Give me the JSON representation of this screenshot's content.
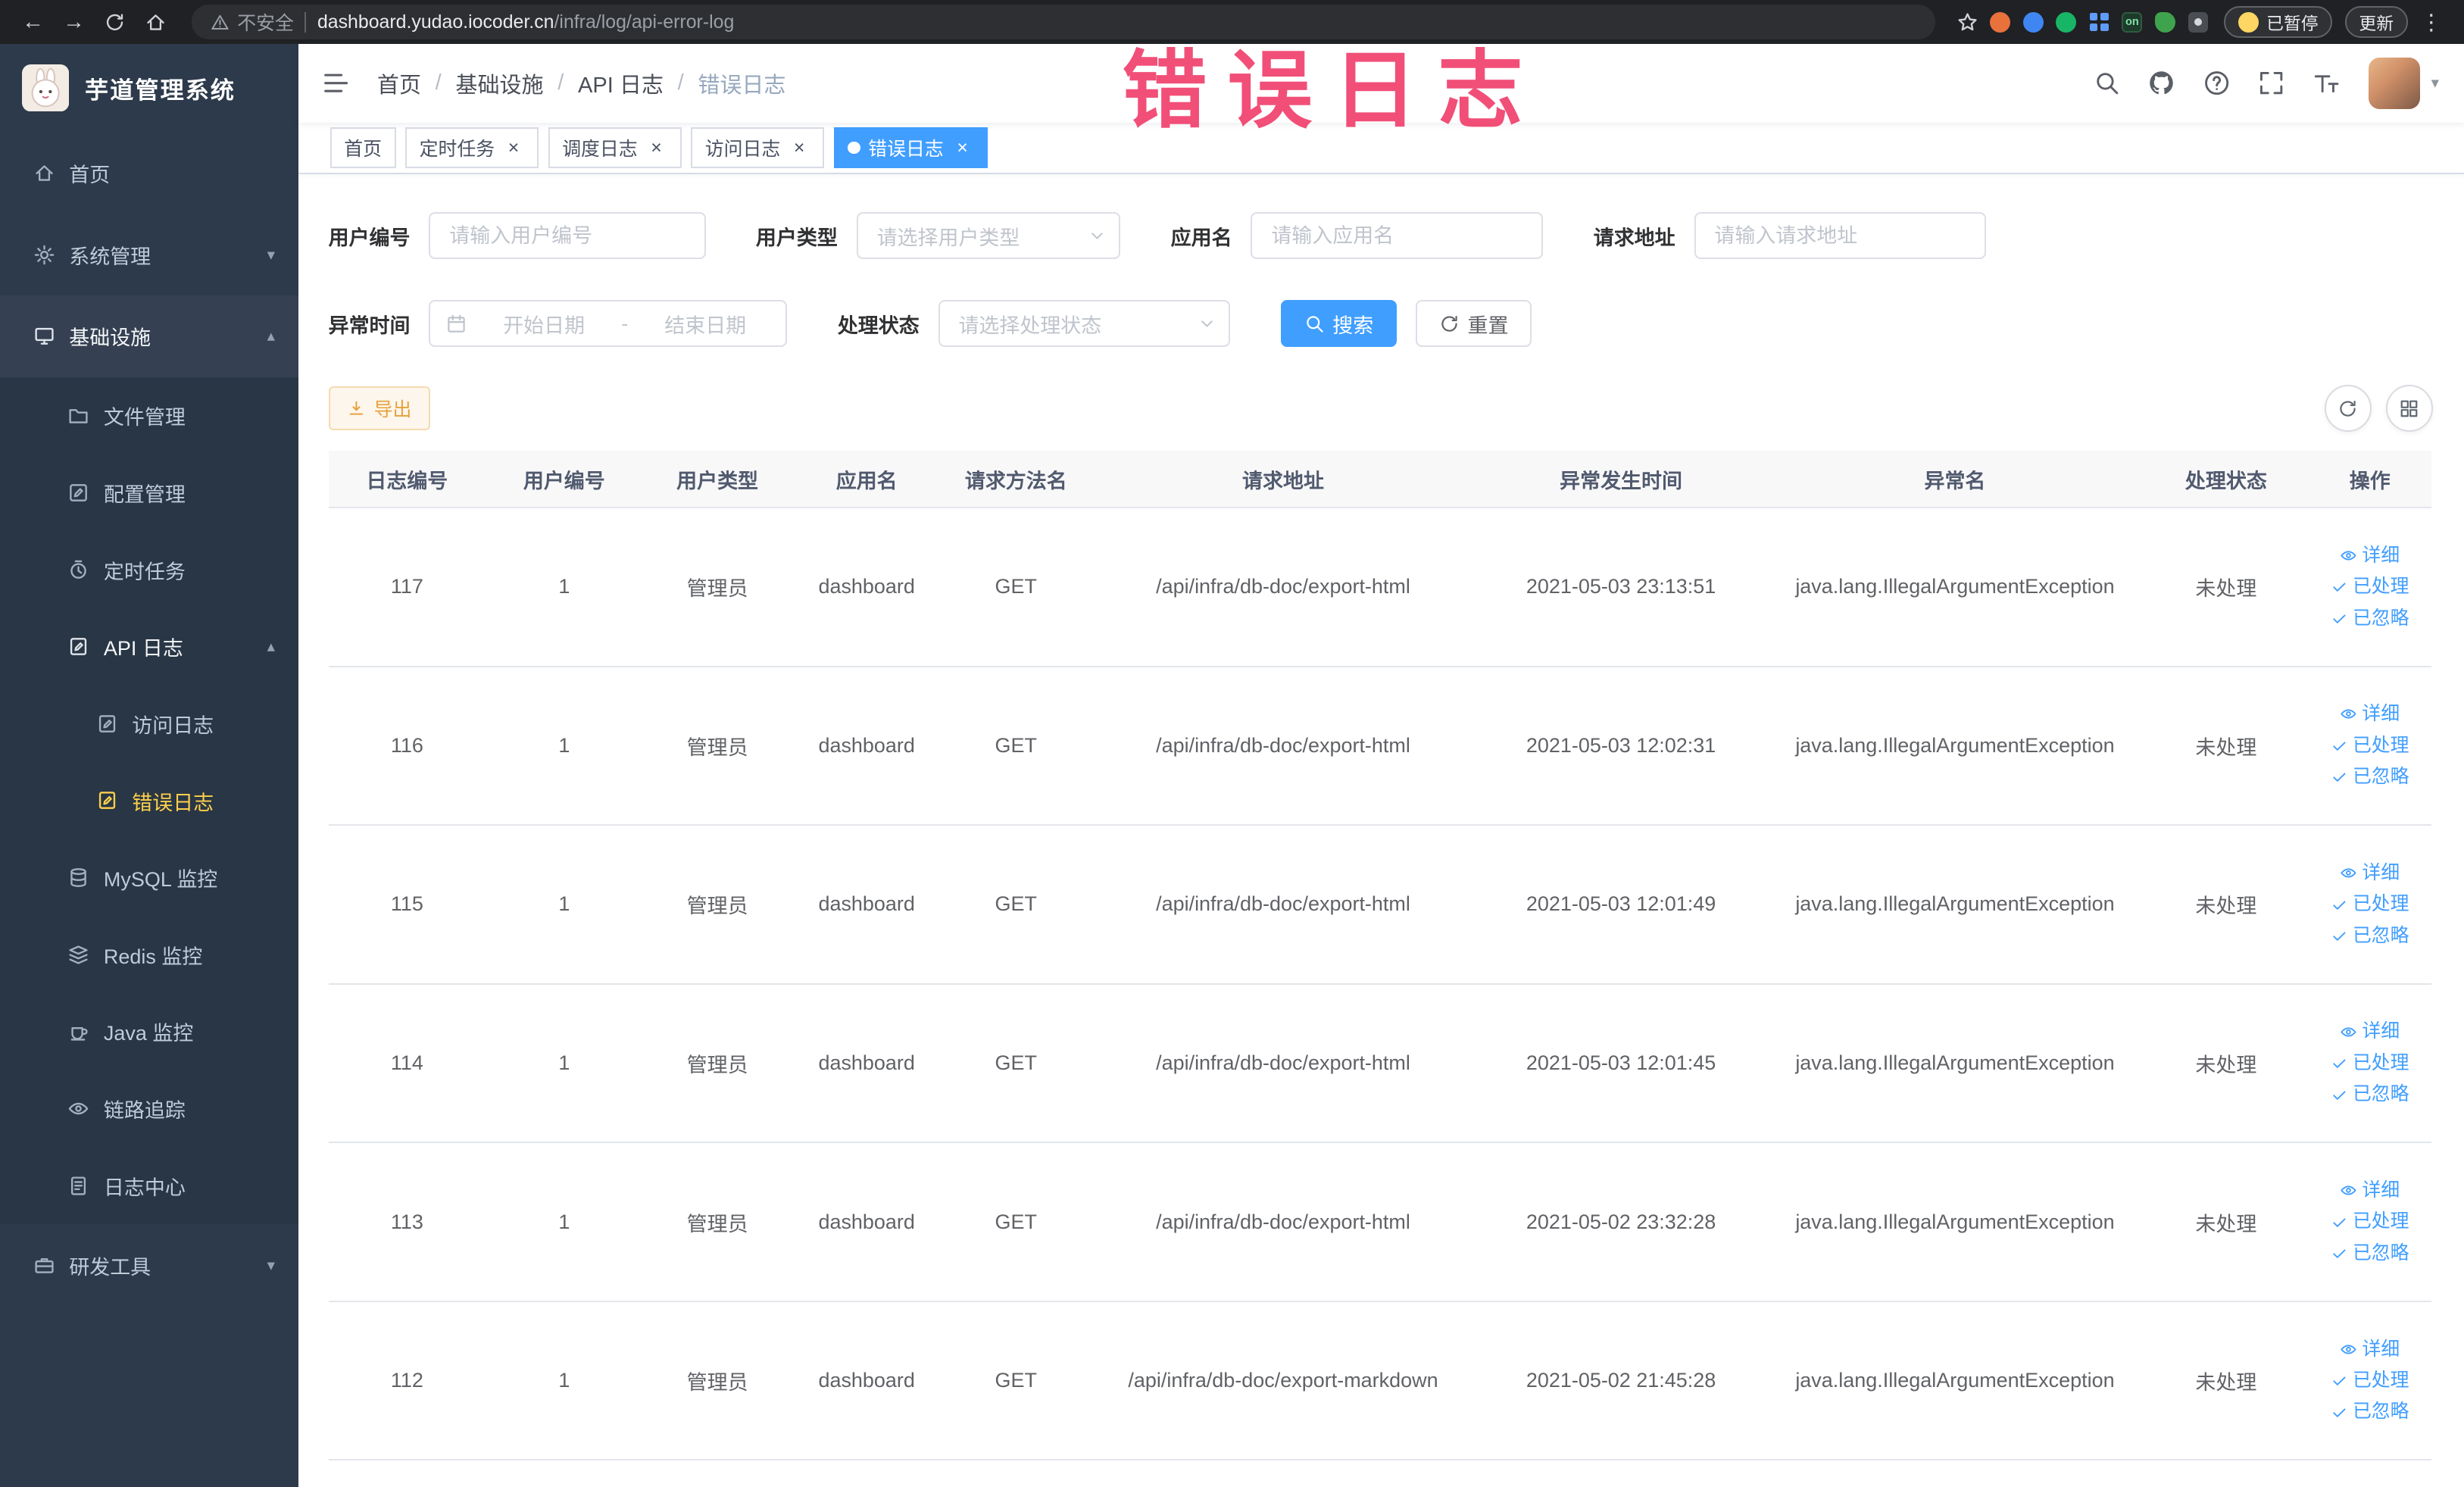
{
  "browser": {
    "security_label": "不安全",
    "url_host": "dashboard.yudao.iocoder.cn",
    "url_path": "/infra/log/api-error-log",
    "extension_on_badge": "on",
    "paused_badge": "已暂停",
    "update_button": "更新"
  },
  "sidebar": {
    "logo_title": "芋道管理系统",
    "items": [
      {
        "key": "home",
        "label": "首页",
        "icon": "home-icon",
        "level": 1
      },
      {
        "key": "system-mgmt",
        "label": "系统管理",
        "icon": "gear-icon",
        "level": 1,
        "chevron": "down"
      },
      {
        "key": "infrastructure",
        "label": "基础设施",
        "icon": "monitor-icon",
        "level": 1,
        "chevron": "up",
        "open": true
      },
      {
        "key": "file-mgmt",
        "label": "文件管理",
        "icon": "folder-icon",
        "level": 2
      },
      {
        "key": "config-mgmt",
        "label": "配置管理",
        "icon": "edit-square-icon",
        "level": 2
      },
      {
        "key": "scheduled-jobs",
        "label": "定时任务",
        "icon": "clock-icon",
        "level": 2
      },
      {
        "key": "api-log",
        "label": "API 日志",
        "icon": "doc-edit-icon",
        "level": 2,
        "chevron": "up",
        "open": true
      },
      {
        "key": "access-log",
        "label": "访问日志",
        "icon": "doc-edit-icon",
        "level": 3
      },
      {
        "key": "error-log",
        "label": "错误日志",
        "icon": "doc-edit-icon",
        "level": 3,
        "active": true
      },
      {
        "key": "mysql-monitor",
        "label": "MySQL 监控",
        "icon": "database-icon",
        "level": 2
      },
      {
        "key": "redis-monitor",
        "label": "Redis 监控",
        "icon": "layers-icon",
        "level": 2
      },
      {
        "key": "java-monitor",
        "label": "Java 监控",
        "icon": "coffee-icon",
        "level": 2
      },
      {
        "key": "trace",
        "label": "链路追踪",
        "icon": "eye-icon",
        "level": 2
      },
      {
        "key": "log-center",
        "label": "日志中心",
        "icon": "doc-icon",
        "level": 2
      },
      {
        "key": "dev-tools",
        "label": "研发工具",
        "icon": "briefcase-icon",
        "level": 1,
        "chevron": "down"
      }
    ]
  },
  "navbar": {
    "breadcrumb": [
      "首页",
      "基础设施",
      "API 日志",
      "错误日志"
    ]
  },
  "annotation": "错误日志",
  "tags": [
    {
      "key": "home",
      "label": "首页",
      "closable": false,
      "active": false
    },
    {
      "key": "scheduled-jobs",
      "label": "定时任务",
      "closable": true,
      "active": false
    },
    {
      "key": "schedule-log",
      "label": "调度日志",
      "closable": true,
      "active": false
    },
    {
      "key": "access-log",
      "label": "访问日志",
      "closable": true,
      "active": false
    },
    {
      "key": "error-log",
      "label": "错误日志",
      "closable": true,
      "active": true
    }
  ],
  "filters": {
    "user_id": {
      "label": "用户编号",
      "placeholder": "请输入用户编号",
      "value": ""
    },
    "user_type": {
      "label": "用户类型",
      "placeholder": "请选择用户类型",
      "value": ""
    },
    "app_name": {
      "label": "应用名",
      "placeholder": "请输入应用名",
      "value": ""
    },
    "request_url": {
      "label": "请求地址",
      "placeholder": "请输入请求地址",
      "value": ""
    },
    "exception_time": {
      "label": "异常时间",
      "start_placeholder": "开始日期",
      "separator": "-",
      "end_placeholder": "结束日期"
    },
    "process_status": {
      "label": "处理状态",
      "placeholder": "请选择处理状态",
      "value": ""
    },
    "search_button": "搜索",
    "reset_button": "重置"
  },
  "toolbar": {
    "export_button": "导出"
  },
  "table": {
    "columns": [
      "日志编号",
      "用户编号",
      "用户类型",
      "应用名",
      "请求方法名",
      "请求地址",
      "异常发生时间",
      "异常名",
      "处理状态",
      "操作"
    ],
    "row_actions": [
      "详细",
      "已处理",
      "已忽略"
    ],
    "rows": [
      {
        "log_id": "117",
        "user_id": "1",
        "user_type": "管理员",
        "app_name": "dashboard",
        "method": "GET",
        "url": "/api/infra/db-doc/export-html",
        "time": "2021-05-03 23:13:51",
        "exception": "java.lang.IllegalArgumentException",
        "status": "未处理"
      },
      {
        "log_id": "116",
        "user_id": "1",
        "user_type": "管理员",
        "app_name": "dashboard",
        "method": "GET",
        "url": "/api/infra/db-doc/export-html",
        "time": "2021-05-03 12:02:31",
        "exception": "java.lang.IllegalArgumentException",
        "status": "未处理"
      },
      {
        "log_id": "115",
        "user_id": "1",
        "user_type": "管理员",
        "app_name": "dashboard",
        "method": "GET",
        "url": "/api/infra/db-doc/export-html",
        "time": "2021-05-03 12:01:49",
        "exception": "java.lang.IllegalArgumentException",
        "status": "未处理"
      },
      {
        "log_id": "114",
        "user_id": "1",
        "user_type": "管理员",
        "app_name": "dashboard",
        "method": "GET",
        "url": "/api/infra/db-doc/export-html",
        "time": "2021-05-03 12:01:45",
        "exception": "java.lang.IllegalArgumentException",
        "status": "未处理"
      },
      {
        "log_id": "113",
        "user_id": "1",
        "user_type": "管理员",
        "app_name": "dashboard",
        "method": "GET",
        "url": "/api/infra/db-doc/export-html",
        "time": "2021-05-02 23:32:28",
        "exception": "java.lang.IllegalArgumentException",
        "status": "未处理"
      },
      {
        "log_id": "112",
        "user_id": "1",
        "user_type": "管理员",
        "app_name": "dashboard",
        "method": "GET",
        "url": "/api/infra/db-doc/export-markdown",
        "time": "2021-05-02 21:45:28",
        "exception": "java.lang.IllegalArgumentException",
        "status": "未处理"
      }
    ]
  },
  "colors": {
    "accent_blue": "#409eff",
    "sidebar_bg": "#2d3a4b",
    "active_menu_text": "#ffd04b",
    "warning_orange": "#e6a23c",
    "annotation_pink": "#f1426e"
  }
}
